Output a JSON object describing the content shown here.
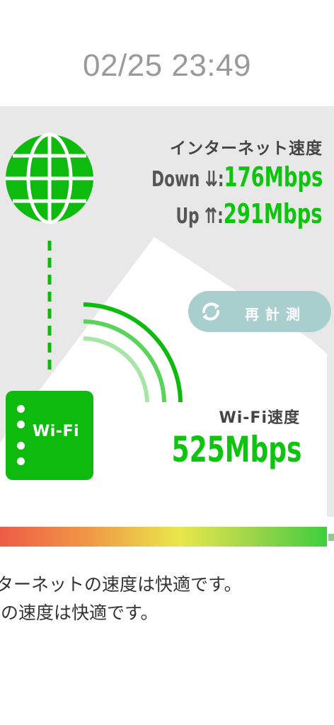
{
  "timestamp": "02/25 23:49",
  "internet": {
    "title": "インターネット速度",
    "down_label": "Down ⇊:",
    "down_value": "176Mbps",
    "up_label": "Up ⇈:",
    "up_value": "291Mbps"
  },
  "remeasure": {
    "label": "再計測",
    "icon": "refresh-icon"
  },
  "wifi": {
    "title": "Wi-Fi速度",
    "value": "525Mbps",
    "router_label": "Wi-Fi"
  },
  "gauge": {
    "colors": [
      "#ee5c45",
      "#e8e84a",
      "#3ccf3c"
    ]
  },
  "messages": [
    "ターネットの速度は快適です。",
    "iの速度は快適です。"
  ],
  "colors": {
    "accent_green": "#0dba0d",
    "button_teal": "#a9cece",
    "panel_gray": "#e8e8e8"
  }
}
